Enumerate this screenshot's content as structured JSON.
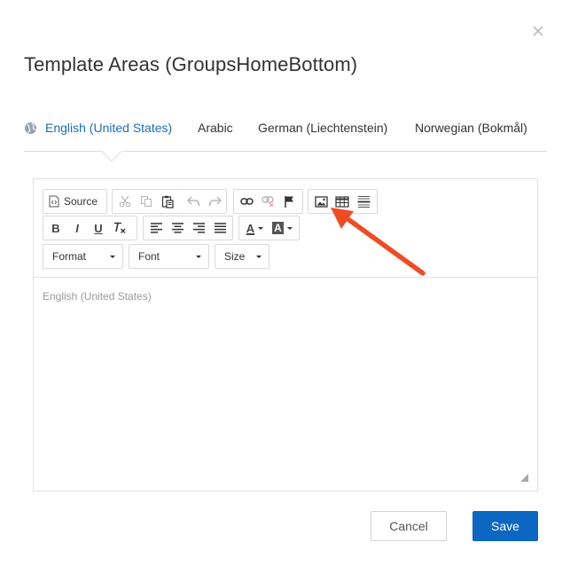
{
  "dialog": {
    "title": "Template Areas (GroupsHomeBottom)",
    "close_icon": "close-icon"
  },
  "tabs": [
    {
      "label": "English (United States)",
      "active": true
    },
    {
      "label": "Arabic",
      "active": false
    },
    {
      "label": "German (Liechtenstein)",
      "active": false
    },
    {
      "label": "Norwegian (Bokmål)",
      "active": false
    }
  ],
  "toolbar": {
    "source_label": "Source",
    "bold_label": "B",
    "italic_label": "I",
    "underline_label": "U",
    "text_color_label": "A",
    "bg_color_label": "A",
    "format_label": "Format",
    "font_label": "Font",
    "size_label": "Size"
  },
  "editor": {
    "placeholder": "English (United States)"
  },
  "footer": {
    "cancel_label": "Cancel",
    "save_label": "Save"
  },
  "colors": {
    "accent": "#0b67c2",
    "active_tab": "#1e6bb8",
    "annotation_arrow": "#f04b23"
  }
}
